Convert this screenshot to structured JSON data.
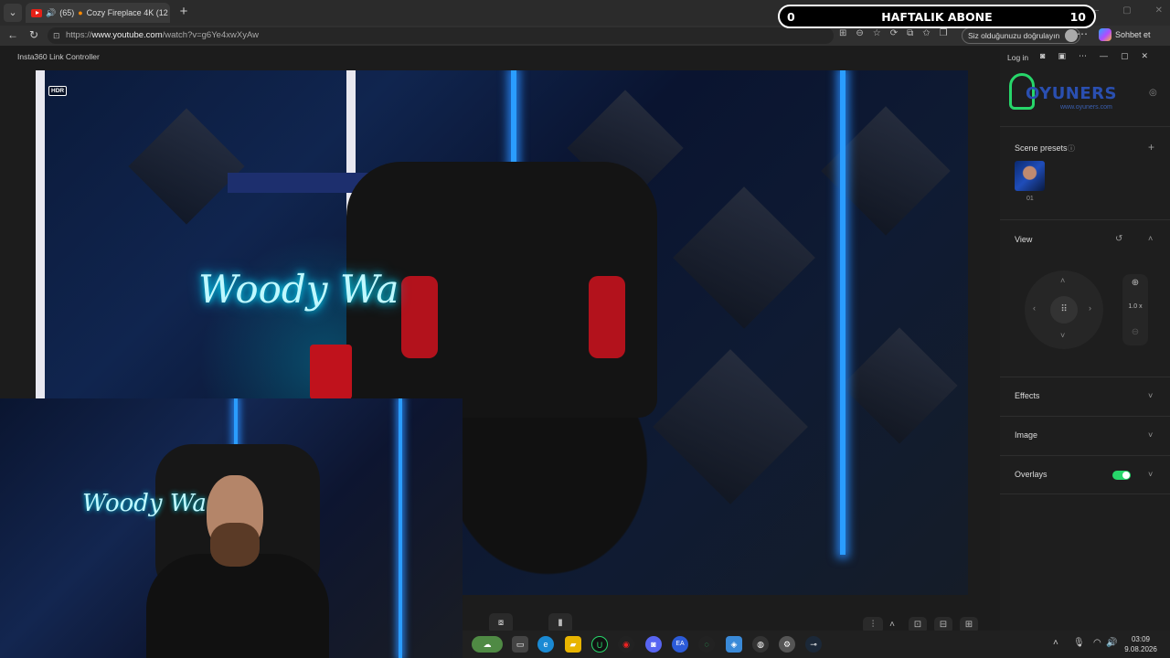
{
  "browser": {
    "tab_title": "Cozy Fireplace 4K (12",
    "tab_count": "(65)",
    "url_prefix": "https://",
    "url_host": "www.youtube.com",
    "url_path": "/watch?v=g6Ye4xwXyAw",
    "verify_text": "Siz olduğunuzu doğrulayın",
    "copilot_label": "Sohbet et"
  },
  "goal": {
    "current": "0",
    "label": "HAFTALIK ABONE",
    "target": "10"
  },
  "app": {
    "title": "Insta360 Link Controller",
    "hdr_badge": "HDR",
    "neon_sign": "Woody Wa"
  },
  "side": {
    "login": "Log in",
    "logo_text": "OYUNERS",
    "logo_sub": "www.oyuners.com",
    "scene_presets": "Scene presets",
    "preset_label": "01",
    "view": "View",
    "zoom_value": "1.0 x",
    "effects": "Effects",
    "image": "Image",
    "overlays": "Overlays",
    "overlays_on": true
  },
  "taskbar": {
    "time": "03:09",
    "date": "9.08.2026"
  },
  "colors": {
    "accent_green": "#27d66a",
    "youtube_red": "#e62117",
    "led_blue": "#2a9dff"
  }
}
